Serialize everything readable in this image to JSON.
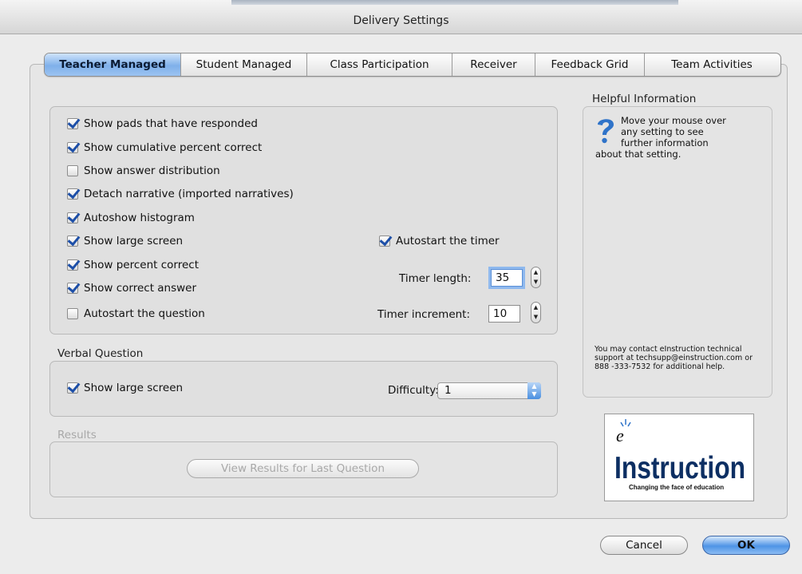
{
  "window": {
    "title": "Delivery Settings"
  },
  "tabs": [
    {
      "label": "Teacher Managed",
      "active": true
    },
    {
      "label": "Student Managed",
      "active": false
    },
    {
      "label": "Class Participation",
      "active": false
    },
    {
      "label": "Receiver",
      "active": false
    },
    {
      "label": "Feedback Grid",
      "active": false
    },
    {
      "label": "Team Activities",
      "active": false
    }
  ],
  "teacher": {
    "options": [
      {
        "label": "Show pads that have responded",
        "checked": true
      },
      {
        "label": "Show cumulative percent correct",
        "checked": true
      },
      {
        "label": "Show answer distribution",
        "checked": false
      },
      {
        "label": "Detach narrative (imported narratives)",
        "checked": true
      },
      {
        "label": "Autoshow histogram",
        "checked": true
      },
      {
        "label": "Show large screen",
        "checked": true
      },
      {
        "label": "Show percent correct",
        "checked": true
      },
      {
        "label": "Show correct answer",
        "checked": true
      },
      {
        "label": "Autostart the question",
        "checked": false
      }
    ],
    "timer": {
      "autostart_label": "Autostart the timer",
      "autostart_checked": true,
      "length_label": "Timer length:",
      "length_value": "35",
      "increment_label": "Timer increment:",
      "increment_value": "10"
    }
  },
  "verbal": {
    "title": "Verbal Question",
    "large_screen_label": "Show large screen",
    "large_screen_checked": true,
    "difficulty_label": "Difficulty:",
    "difficulty_value": "1"
  },
  "results": {
    "title": "Results",
    "view_button": "View Results for Last Question"
  },
  "help": {
    "title": "Helpful Information",
    "line1": "Move your mouse over",
    "line2": "any setting to see",
    "line3": "further information",
    "line4": "about that setting.",
    "contact": "You may contact eInstruction technical support at techsupp@einstruction.com or 888 -333-7532 for additional help."
  },
  "logo": {
    "brand_e": "e",
    "brand": "Instruction",
    "tagline": "Changing the face of education"
  },
  "buttons": {
    "cancel": "Cancel",
    "ok": "OK"
  },
  "colors": {
    "accent": "#4e94e6",
    "check": "#1d4fa8",
    "tab_active": "#7fb0ea"
  }
}
